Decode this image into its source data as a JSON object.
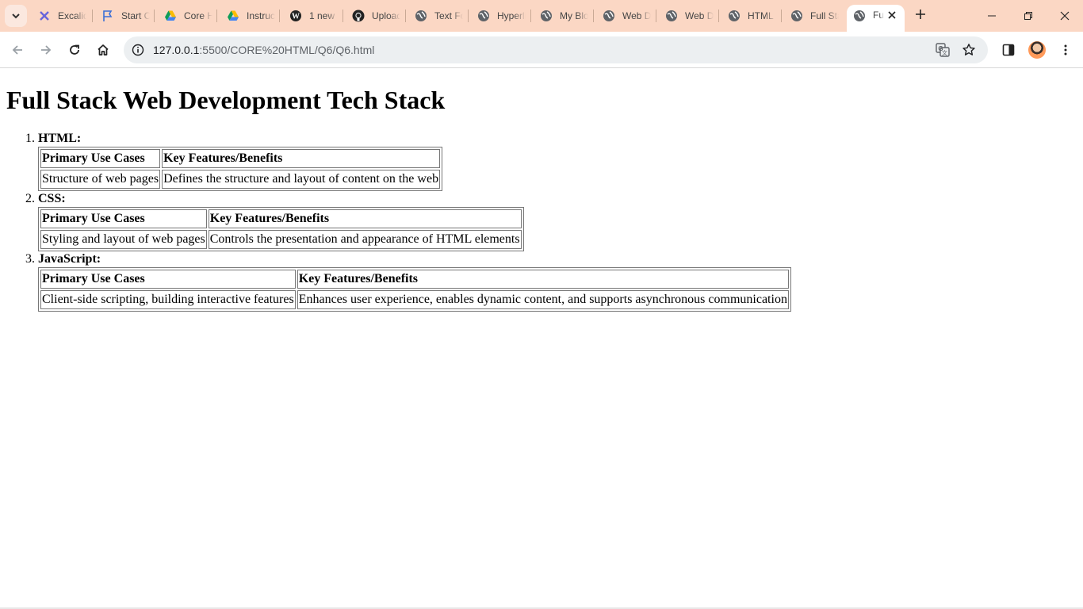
{
  "browser": {
    "tabs": [
      {
        "title": "Excalidraw",
        "icon": "excalidraw-icon"
      },
      {
        "title": "Start Course",
        "icon": "flag-icon"
      },
      {
        "title": "Core HTML",
        "icon": "google-drive-icon"
      },
      {
        "title": "Instructions",
        "icon": "google-drive-icon"
      },
      {
        "title": "1 new",
        "icon": "wordpress-icon"
      },
      {
        "title": "Upload",
        "icon": "github-icon"
      },
      {
        "title": "Text Formatting",
        "icon": "globe-icon"
      },
      {
        "title": "Hyperlinks",
        "icon": "globe-icon"
      },
      {
        "title": "My Blog",
        "icon": "globe-icon"
      },
      {
        "title": "Web Dev",
        "icon": "globe-icon"
      },
      {
        "title": "Web Dev",
        "icon": "globe-icon"
      },
      {
        "title": "HTML",
        "icon": "globe-icon"
      },
      {
        "title": "Full Stack",
        "icon": "globe-icon"
      }
    ],
    "active_tab": {
      "title": "Full Stack Web Development Tech Stack",
      "icon": "globe-icon"
    },
    "url": {
      "host": "127.0.0.1",
      "path": ":5500/CORE%20HTML/Q6/Q6.html"
    }
  },
  "page": {
    "title": "Full Stack Web Development Tech Stack",
    "items": [
      {
        "label": "HTML:",
        "headers": [
          "Primary Use Cases",
          "Key Features/Benefits"
        ],
        "row": [
          "Structure of web pages",
          "Defines the structure and layout of content on the web"
        ]
      },
      {
        "label": "CSS:",
        "headers": [
          "Primary Use Cases",
          "Key Features/Benefits"
        ],
        "row": [
          "Styling and layout of web pages",
          "Controls the presentation and appearance of HTML elements"
        ]
      },
      {
        "label": "JavaScript:",
        "headers": [
          "Primary Use Cases",
          "Key Features/Benefits"
        ],
        "row": [
          "Client-side scripting, building interactive features",
          "Enhances user experience, enables dynamic content, and supports asynchronous communication"
        ]
      }
    ]
  }
}
